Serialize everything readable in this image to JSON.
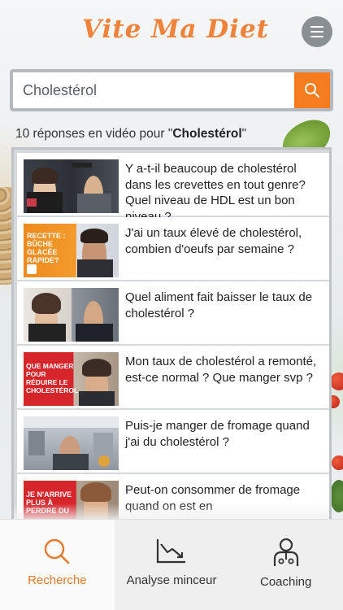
{
  "app": {
    "logo": "Vite Ma Diet"
  },
  "search": {
    "value": "Cholestérol"
  },
  "results": {
    "prefix": "10 réponses en vidéo pour \"",
    "term": "Cholestérol",
    "suffix": "\""
  },
  "items": [
    {
      "title": "Y a-t-il beaucoup de cholestérol dans les crevettes en tout genre? Quel niveau de HDL est un bon niveau ?"
    },
    {
      "title": "J'ai un taux élevé de cholestérol, combien d'oeufs par semaine ?",
      "thumb_text": "Recette : bûche glacée rapide?"
    },
    {
      "title": "Quel aliment fait baisser le taux de cholestérol ?"
    },
    {
      "title": "Mon taux de cholestérol a remonté, est-ce normal ? Que manger svp ?",
      "thumb_text": "Que manger pour réduire le cholestérol"
    },
    {
      "title": "Puis-je manger de fromage quand j'ai du cholestérol ?"
    },
    {
      "title": "Peut-on consommer de fromage quand on est en",
      "thumb_text": "Je n'arrive plus à perdre du"
    }
  ],
  "tabs": [
    {
      "label": "Recherche",
      "icon": "search-icon",
      "active": true
    },
    {
      "label": "Analyse minceur",
      "icon": "chart-icon",
      "active": false
    },
    {
      "label": "Coaching",
      "icon": "coach-icon",
      "active": false
    }
  ],
  "colors": {
    "accent": "#f57d1f",
    "logo": "#f0823a"
  }
}
